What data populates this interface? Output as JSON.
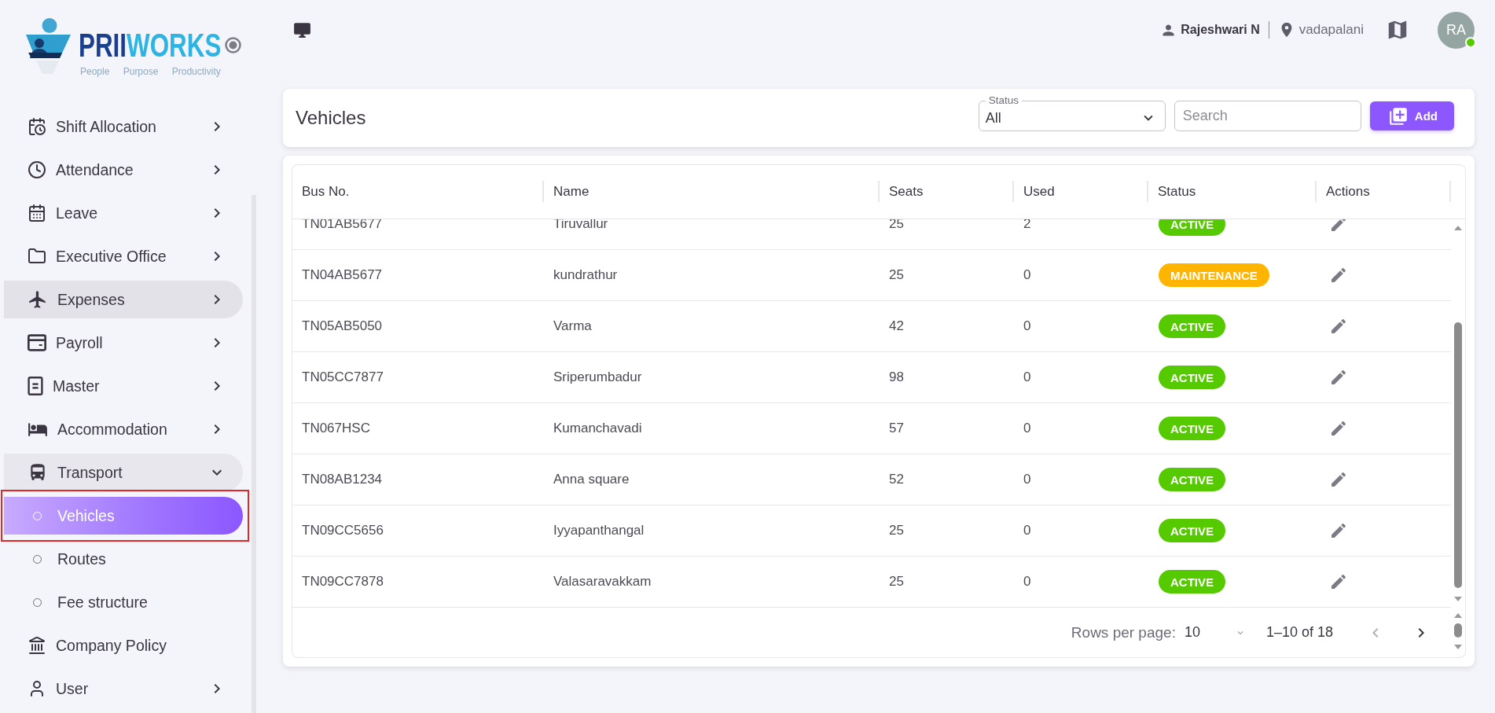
{
  "logo": {
    "wordmark": [
      "PRII",
      "WORKS"
    ],
    "tagline": "People Purpose Productivity"
  },
  "sidebar": {
    "items": [
      {
        "label": "Shift Allocation",
        "kind": "group",
        "expanded": false,
        "hovered": false
      },
      {
        "label": "Attendance",
        "kind": "group",
        "expanded": false,
        "hovered": false
      },
      {
        "label": "Leave",
        "kind": "group",
        "expanded": false,
        "hovered": false
      },
      {
        "label": "Executive Office",
        "kind": "group",
        "expanded": false,
        "hovered": false
      },
      {
        "label": "Expenses",
        "kind": "group",
        "expanded": false,
        "hovered": true
      },
      {
        "label": "Payroll",
        "kind": "group",
        "expanded": false,
        "hovered": false
      },
      {
        "label": "Master",
        "kind": "group",
        "expanded": false,
        "hovered": false
      },
      {
        "label": "Accommodation",
        "kind": "group",
        "expanded": false,
        "hovered": false
      },
      {
        "label": "Transport",
        "kind": "group",
        "expanded": true,
        "hovered": false,
        "children": [
          {
            "label": "Vehicles",
            "selected": true,
            "highlighted": true
          },
          {
            "label": "Routes",
            "selected": false,
            "highlighted": false
          },
          {
            "label": "Fee structure",
            "selected": false,
            "highlighted": false
          }
        ]
      },
      {
        "label": "Company Policy",
        "kind": "link",
        "expanded": false,
        "hovered": false
      },
      {
        "label": "User",
        "kind": "group",
        "expanded": false,
        "hovered": false
      }
    ]
  },
  "header": {
    "user_name": "Rajeshwari N",
    "location": "vadapalani",
    "avatar": {
      "initials": "RA",
      "online": true
    }
  },
  "toolbar": {
    "title": "Vehicles",
    "status_filter": {
      "label": "Status",
      "value": "All"
    },
    "search": {
      "placeholder": "Search"
    },
    "add_button": "Add"
  },
  "table": {
    "columns": [
      "Bus No.",
      "Name",
      "Seats",
      "Used",
      "Status",
      "Actions"
    ],
    "rows": [
      {
        "bus_no": "TN01AB5677",
        "name": "Tiruvallur",
        "seats": "25",
        "used": "2",
        "status": {
          "label": "ACTIVE",
          "color": "#56ca00"
        }
      },
      {
        "bus_no": "TN04AB5677",
        "name": "kundrathur",
        "seats": "25",
        "used": "0",
        "status": {
          "label": "MAINTENANCE",
          "color": "#ffb400"
        }
      },
      {
        "bus_no": "TN05AB5050",
        "name": "Varma",
        "seats": "42",
        "used": "0",
        "status": {
          "label": "ACTIVE",
          "color": "#56ca00"
        }
      },
      {
        "bus_no": "TN05CC7877",
        "name": "Sriperumbadur",
        "seats": "98",
        "used": "0",
        "status": {
          "label": "ACTIVE",
          "color": "#56ca00"
        }
      },
      {
        "bus_no": "TN067HSC",
        "name": "Kumanchavadi",
        "seats": "57",
        "used": "0",
        "status": {
          "label": "ACTIVE",
          "color": "#56ca00"
        }
      },
      {
        "bus_no": "TN08AB1234",
        "name": "Anna square",
        "seats": "52",
        "used": "0",
        "status": {
          "label": "ACTIVE",
          "color": "#56ca00"
        }
      },
      {
        "bus_no": "TN09CC5656",
        "name": "Iyyapanthangal",
        "seats": "25",
        "used": "0",
        "status": {
          "label": "ACTIVE",
          "color": "#56ca00"
        }
      },
      {
        "bus_no": "TN09CC7878",
        "name": "Valasaravakkam",
        "seats": "25",
        "used": "0",
        "status": {
          "label": "ACTIVE",
          "color": "#56ca00"
        }
      }
    ]
  },
  "pagination": {
    "rows_per_page_label": "Rows per page:",
    "rows_per_page": "10",
    "range": "1–10 of 18",
    "previous_disabled": true,
    "next_disabled": false
  }
}
